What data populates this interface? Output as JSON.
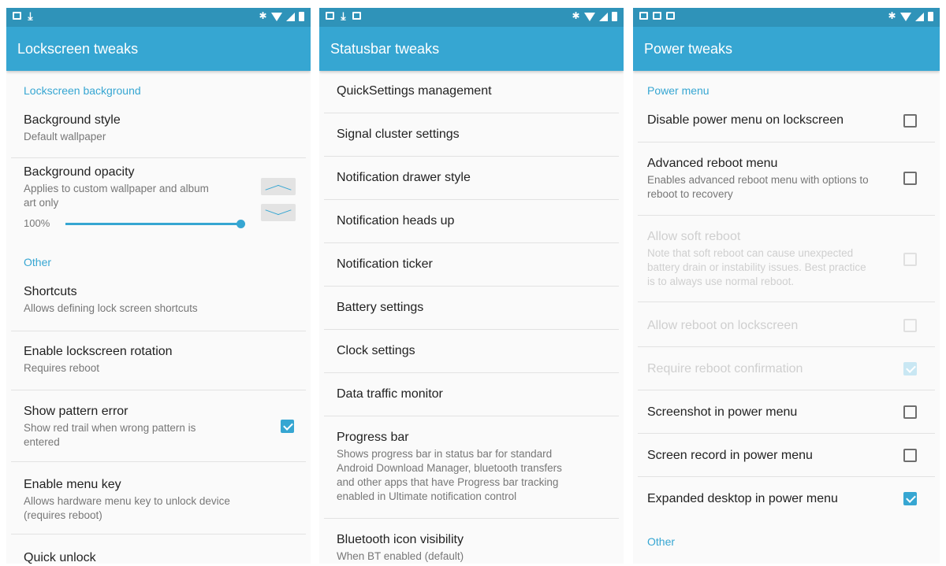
{
  "panels": {
    "lockscreen": {
      "title": "Lockscreen tweaks",
      "sections": {
        "background": "Lockscreen background",
        "other": "Other"
      },
      "items": {
        "background_style": {
          "title": "Background style",
          "summary": "Default wallpaper"
        },
        "background_opacity": {
          "title": "Background opacity",
          "summary": "Applies to custom wallpaper and album art only",
          "value_label": "100%",
          "value": 1.0
        },
        "shortcuts": {
          "title": "Shortcuts",
          "summary": "Allows defining lock screen shortcuts"
        },
        "rotation": {
          "title": "Enable lockscreen rotation",
          "summary": "Requires reboot"
        },
        "pattern_error": {
          "title": "Show pattern error",
          "summary": "Show red trail when wrong pattern is entered",
          "checked": true
        },
        "menu_key": {
          "title": "Enable menu key",
          "summary": "Allows hardware menu key to unlock device (requires reboot)"
        },
        "quick_unlock": {
          "title": "Quick unlock"
        }
      }
    },
    "statusbar": {
      "title": "Statusbar tweaks",
      "items": {
        "quicksettings": {
          "title": "QuickSettings management"
        },
        "signal_cluster": {
          "title": "Signal cluster settings"
        },
        "drawer_style": {
          "title": "Notification drawer style"
        },
        "heads_up": {
          "title": "Notification heads up"
        },
        "ticker": {
          "title": "Notification ticker"
        },
        "battery": {
          "title": "Battery settings"
        },
        "clock": {
          "title": "Clock settings"
        },
        "data_traffic": {
          "title": "Data traffic monitor"
        },
        "progress_bar": {
          "title": "Progress bar",
          "summary": "Shows progress bar in status bar for standard Android Download Manager, bluetooth transfers and other apps that have Progress bar tracking enabled in Ultimate notification control"
        },
        "bt_icon": {
          "title": "Bluetooth icon visibility",
          "summary": "When BT enabled (default)"
        }
      }
    },
    "power": {
      "title": "Power tweaks",
      "sections": {
        "power_menu": "Power menu",
        "other": "Other"
      },
      "items": {
        "disable_lock": {
          "title": "Disable power menu on lockscreen",
          "checked": false
        },
        "advanced_reboot": {
          "title": "Advanced reboot menu",
          "summary": "Enables advanced reboot menu with options to reboot to recovery",
          "checked": false
        },
        "soft_reboot": {
          "title": "Allow soft reboot",
          "summary": "Note that soft reboot can cause unexpected battery drain or instability issues. Best practice is to always use normal reboot.",
          "checked": false,
          "enabled": false
        },
        "reboot_lock": {
          "title": "Allow reboot on lockscreen",
          "checked": false,
          "enabled": false
        },
        "reboot_confirm": {
          "title": "Require reboot confirmation",
          "checked": true,
          "enabled": false
        },
        "screenshot": {
          "title": "Screenshot in power menu",
          "checked": false
        },
        "screenrecord": {
          "title": "Screen record in power menu",
          "checked": false
        },
        "expanded_desktop": {
          "title": "Expanded desktop in power menu",
          "checked": true
        }
      }
    }
  },
  "colors": {
    "statusbar": "#2f93b9",
    "appbar": "#36a6d2",
    "accent": "#36a6d2"
  },
  "icons": [
    "image-icon",
    "download-icon",
    "bluetooth-icon",
    "wifi-icon",
    "signal-icon",
    "battery-icon",
    "checkbox-icon",
    "chevron-up-icon",
    "chevron-down-icon"
  ]
}
